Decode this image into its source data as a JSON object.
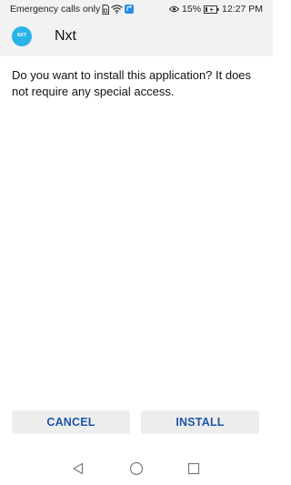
{
  "status_bar": {
    "carrier_text": "Emergency calls only",
    "battery_percent": "15%",
    "time": "12:27 PM"
  },
  "icons": {
    "sim": "sim-card-icon",
    "wifi": "wifi-icon",
    "notification": "app-notification-icon",
    "eye": "eye-comfort-icon",
    "battery": "battery-icon",
    "back": "back-triangle-icon",
    "home": "home-circle-icon",
    "recent": "recent-apps-square-icon"
  },
  "app": {
    "icon_text": "NXT",
    "name": "Nxt"
  },
  "dialog": {
    "message": "Do you want to install this application? It does not require any special access."
  },
  "buttons": {
    "cancel": "CANCEL",
    "install": "INSTALL"
  },
  "colors": {
    "accent": "#1f56a6",
    "app_icon": "#2ab3ea",
    "header_bg": "#f2f2f2",
    "button_bg": "#ededed"
  }
}
